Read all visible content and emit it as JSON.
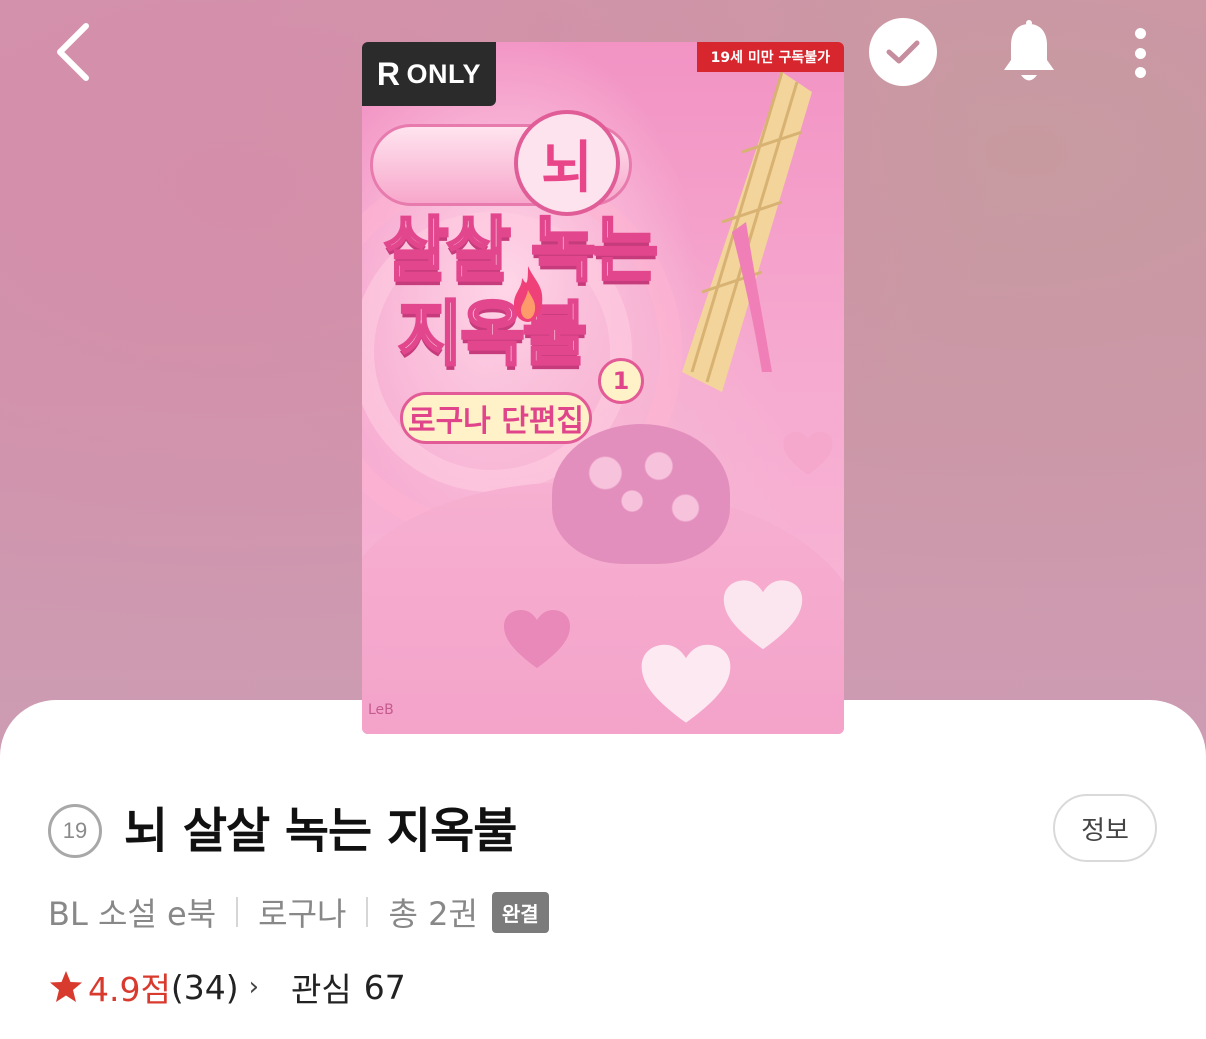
{
  "header": {
    "back_icon": "chevron-left-icon",
    "check_icon": "check-icon",
    "bell_icon": "bell-icon",
    "more_icon": "more-vertical-icon"
  },
  "cover": {
    "r_only_mark": "R",
    "r_only_label": "ONLY",
    "age_notice": "19세 미만 구독불가",
    "title_big": "뇌",
    "title_line1": "살살 녹는",
    "title_line2": "지옥불",
    "subtitle": "로구나 단편집",
    "volume": "1",
    "publisher_mark": "LeB"
  },
  "book": {
    "age_rating": "19",
    "title": "뇌 살살 녹는 지옥불",
    "info_button": "정보",
    "category": "BL 소설 e북",
    "author": "로구나",
    "volumes": "총 2권",
    "status": "완결",
    "rating": "4.9점",
    "review_count": "(34)",
    "interest_label": "관심",
    "interest_count": "67"
  },
  "colors": {
    "accent_red": "#d83a2e",
    "status_badge": "#7b7b7b",
    "hero_pink": "#d394ad"
  }
}
